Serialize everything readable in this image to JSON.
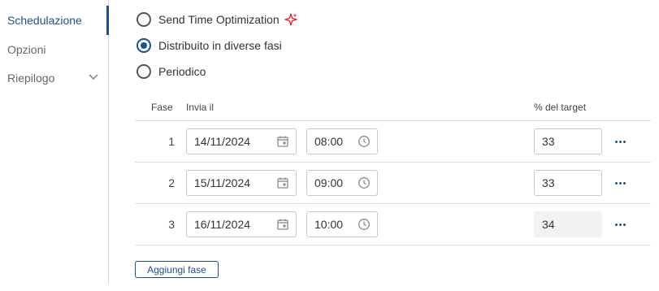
{
  "sidebar": {
    "items": [
      {
        "label": "Schedulazione",
        "active": true
      },
      {
        "label": "Opzioni",
        "active": false
      },
      {
        "label": "Riepilogo",
        "active": false,
        "expandable": true
      }
    ]
  },
  "send_mode": {
    "options": [
      {
        "label": "Send Time Optimization",
        "checked": false,
        "icon": "sparkle-icon"
      },
      {
        "label": "Distribuito in diverse fasi",
        "checked": true
      },
      {
        "label": "Periodico",
        "checked": false
      }
    ]
  },
  "phases_table": {
    "headers": {
      "phase": "Fase",
      "send_at": "Invia il",
      "target_pct": "% del target"
    },
    "rows": [
      {
        "phase": "1",
        "date": "14/11/2024",
        "time": "08:00",
        "target_pct": "33",
        "pct_editable": true
      },
      {
        "phase": "2",
        "date": "15/11/2024",
        "time": "09:00",
        "target_pct": "33",
        "pct_editable": true
      },
      {
        "phase": "3",
        "date": "16/11/2024",
        "time": "10:00",
        "target_pct": "34",
        "pct_editable": false
      }
    ]
  },
  "add_phase_label": "Aggiungi fase",
  "colors": {
    "accent": "#1f4e8c",
    "sparkle": "#e0242e",
    "readonly_bg": "#f2f2f2",
    "divider": "#dcdcdc"
  }
}
